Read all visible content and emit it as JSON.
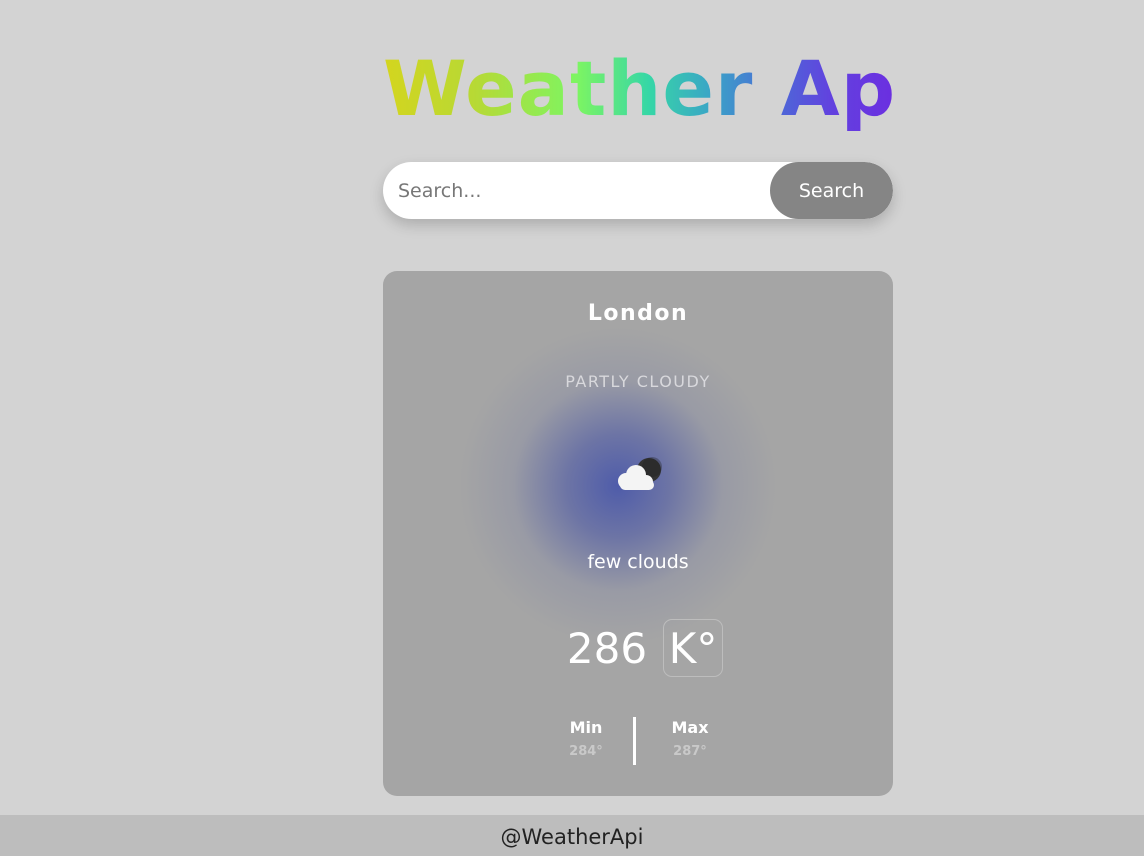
{
  "app": {
    "title": "Weather App"
  },
  "search": {
    "placeholder": "Search...",
    "value": "",
    "button_label": "Search"
  },
  "weather": {
    "city": "London",
    "condition": "PARTLY CLOUDY",
    "icon": "partly-cloudy-night-icon",
    "description": "few clouds",
    "temperature": "286",
    "unit": "K°",
    "min_label": "Min",
    "min_value": "284°",
    "max_label": "Max",
    "max_value": "287°"
  },
  "footer": {
    "text": "@WeatherApi"
  },
  "colors": {
    "background": "#d3d3d3",
    "card": "#a5a5a5",
    "search_button": "#858585",
    "footer": "#bdbdbd",
    "title_gradient": [
      "#d4d51e",
      "#7df562",
      "#3aa6c6",
      "#6b2fe0"
    ]
  }
}
